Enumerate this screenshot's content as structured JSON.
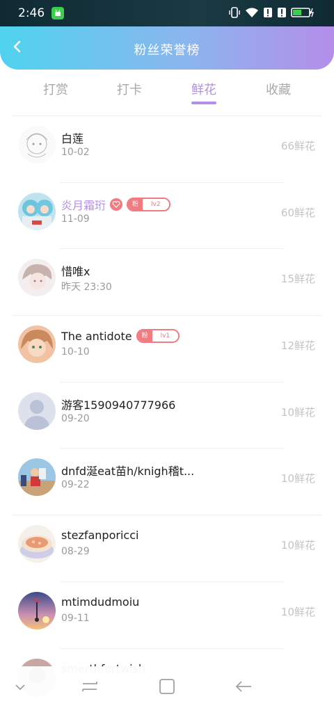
{
  "status_bar": {
    "time": "2:46",
    "icons": [
      "android-notification-icon",
      "vibrate-icon",
      "wifi-icon",
      "signal-alert-icon",
      "signal-alert-icon",
      "battery-charging-icon"
    ]
  },
  "header": {
    "title": "粉丝荣誉榜",
    "back_icon": "chevron-left-icon"
  },
  "tabs": [
    {
      "label": "打赏",
      "active": false
    },
    {
      "label": "打卡",
      "active": false
    },
    {
      "label": "鲜花",
      "active": true
    },
    {
      "label": "收藏",
      "active": false
    }
  ],
  "colors": {
    "accent": "#b48ee9",
    "header_gradient_start": "#4fd3ef",
    "header_gradient_end": "#b48ee9",
    "badge_red": "#f07b80"
  },
  "fans": [
    {
      "name": "白莲",
      "date": "10-02",
      "amount": "66鲜花"
    },
    {
      "name": "炎月霜珩",
      "date": "11-09",
      "amount": "60鲜花",
      "fan_badge": "粉",
      "level": "lv2"
    },
    {
      "name": "惜唯x",
      "date": "昨天 23:30",
      "amount": "15鲜花"
    },
    {
      "name": "The antidote",
      "date": "10-10",
      "amount": "12鲜花",
      "fan_badge": "粉",
      "level": "lv1"
    },
    {
      "name": "游客1590940777966",
      "date": "09-20",
      "amount": "10鲜花"
    },
    {
      "name": "dnfd涎eat苗h/knigh稽t...",
      "date": "09-22",
      "amount": "10鲜花"
    },
    {
      "name": "stezfanporicci",
      "date": "08-29",
      "amount": "10鲜花"
    },
    {
      "name": "mtimdudmoiu",
      "date": "09-11",
      "amount": "10鲜花"
    },
    {
      "name": "smerthfortwish",
      "date": "",
      "amount": ""
    }
  ],
  "nav_bar": [
    "collapse-icon",
    "recent-apps-icon",
    "home-icon",
    "back-icon"
  ]
}
